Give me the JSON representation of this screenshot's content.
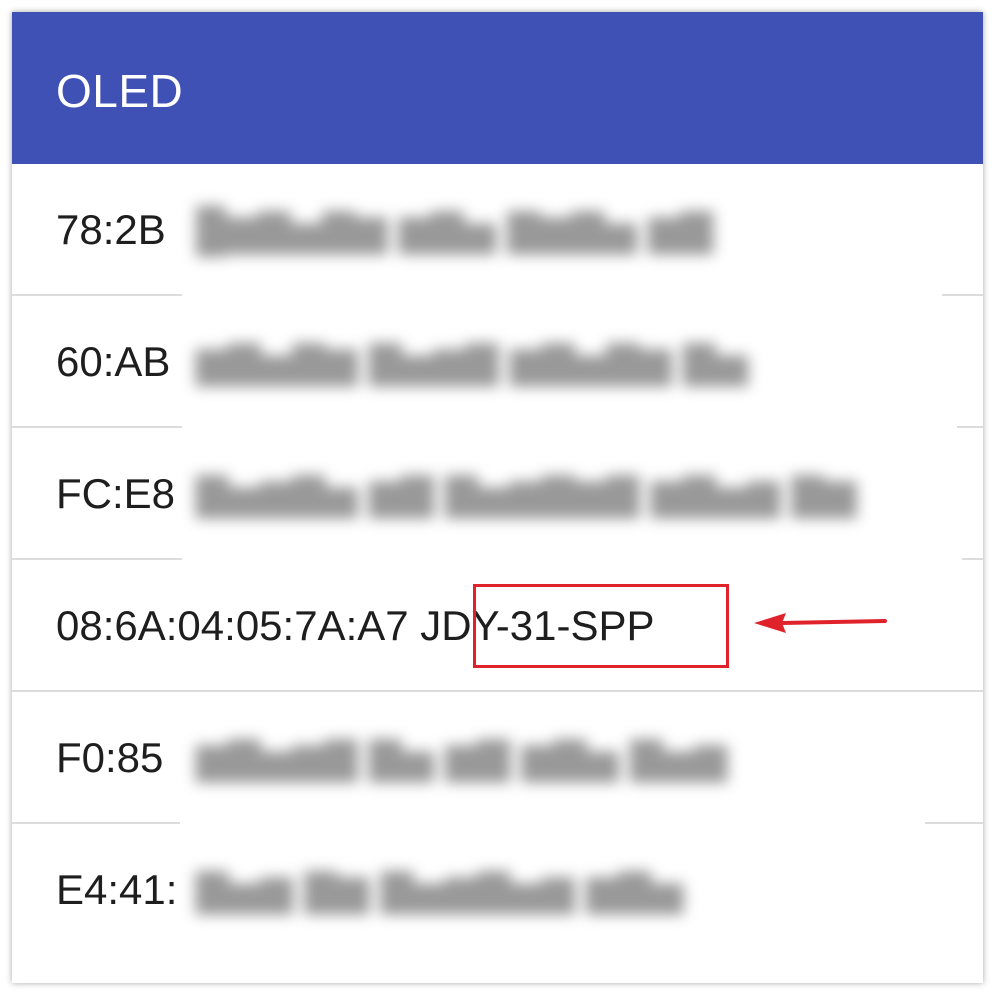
{
  "app_bar": {
    "title": "OLED",
    "color": "#3f51b5"
  },
  "devices": [
    {
      "address_visible": "78:2B",
      "obscured": true
    },
    {
      "address_visible": "60:AB",
      "obscured": true
    },
    {
      "address_visible": "FC:E8",
      "obscured": true
    },
    {
      "address": "08:6A:04:05:7A:A7",
      "name": "JDY-31-SPP",
      "obscured": false,
      "highlighted": true
    },
    {
      "address_visible": "F0:85",
      "obscured": true
    },
    {
      "address_visible": "E4:41:",
      "obscured": true
    }
  ],
  "annotation": {
    "type": "arrow",
    "target": "JDY-31-SPP",
    "color": "#e0232b"
  }
}
